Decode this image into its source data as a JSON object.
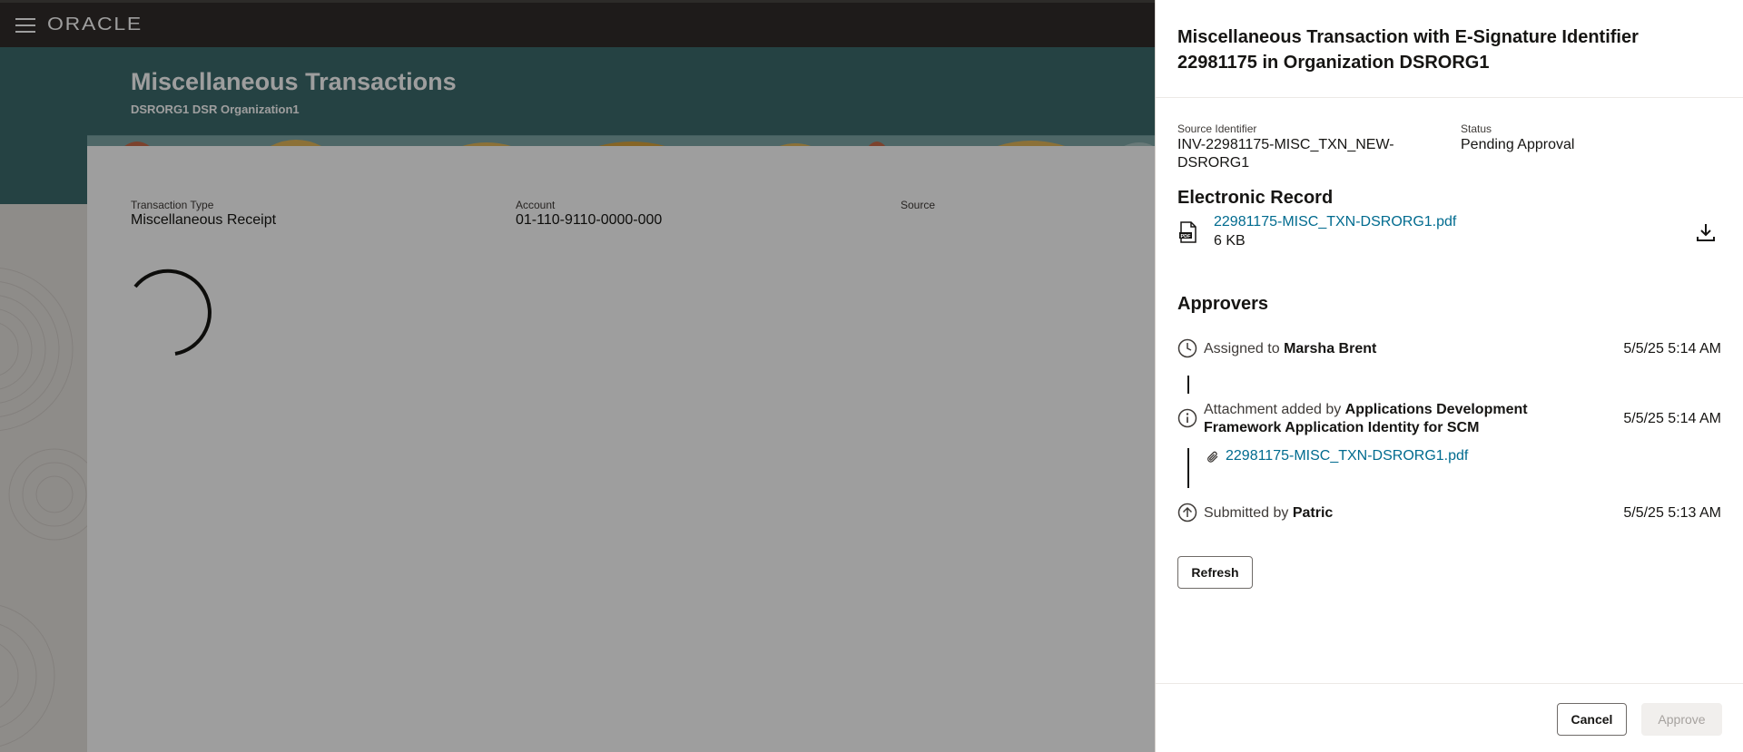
{
  "app": {
    "logo": "ORACLE",
    "page_title": "Miscellaneous Transactions",
    "page_subtitle": "DSRORG1 DSR Organization1"
  },
  "fields": {
    "transaction_type_label": "Transaction Type",
    "transaction_type_value": "Miscellaneous Receipt",
    "account_label": "Account",
    "account_value": "01-110-9110-0000-000",
    "source_label": "Source"
  },
  "drawer": {
    "title": "Miscellaneous Transaction with E-Signature Identifier 22981175 in Organization DSRORG1",
    "source_identifier_label": "Source Identifier",
    "source_identifier_value": "INV-22981175-MISC_TXN_NEW-DSRORG1",
    "status_label": "Status",
    "status_value": "Pending Approval",
    "electronic_record": {
      "heading": "Electronic Record",
      "file_icon": "pdf-file-icon",
      "file_name": "22981175-MISC_TXN-DSRORG1.pdf",
      "file_size": "6 KB",
      "download_icon": "download-icon"
    },
    "approvers": {
      "heading": "Approvers",
      "items": [
        {
          "icon": "clock-icon",
          "prefix": "Assigned to ",
          "name": "Marsha Brent",
          "time": "5/5/25 5:14 AM"
        },
        {
          "icon": "info-icon",
          "prefix": "Attachment added by ",
          "name": "Applications Development Framework Application Identity for SCM",
          "time": "5/5/25 5:14 AM",
          "attachment_icon": "paperclip-icon",
          "attachment": "22981175-MISC_TXN-DSRORG1.pdf"
        },
        {
          "icon": "arrow-up-circle-icon",
          "prefix": "Submitted by ",
          "name": "Patric",
          "time": "5/5/25 5:13 AM"
        }
      ]
    },
    "refresh_label": "Refresh",
    "cancel_label": "Cancel",
    "approve_label": "Approve"
  },
  "colors": {
    "topbar": "#312d2a",
    "banner": "#3c6b6c",
    "link": "#006b8f",
    "approve_disabled_bg": "#f1efed"
  }
}
